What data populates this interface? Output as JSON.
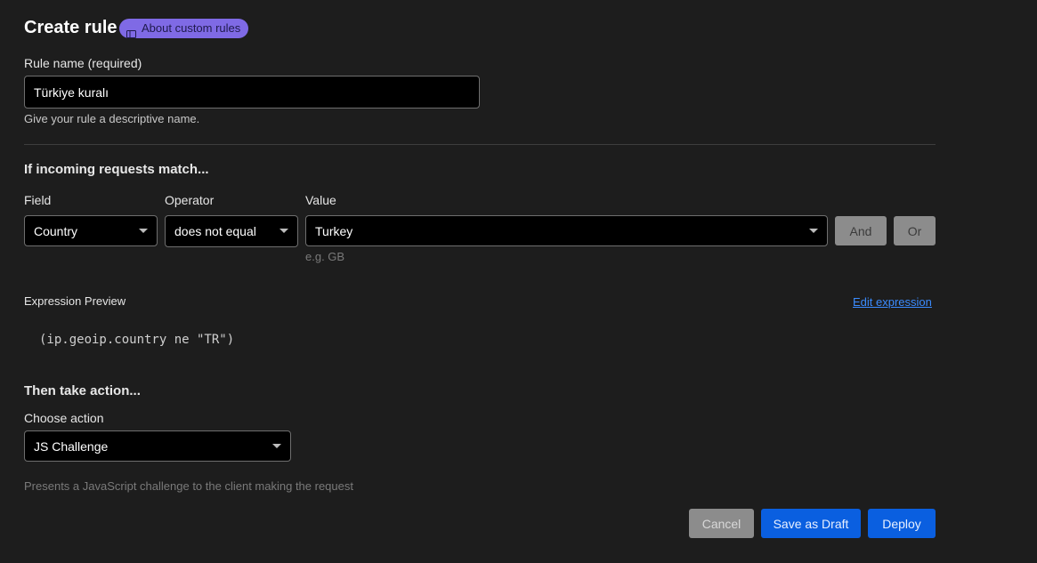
{
  "header": {
    "title": "Create rule",
    "about_link": "About custom rules",
    "about_icon": "book-icon"
  },
  "rule_name": {
    "label": "Rule name (required)",
    "value": "Türkiye kuralı",
    "help": "Give your rule a descriptive name."
  },
  "match": {
    "heading": "If incoming requests match...",
    "field_label": "Field",
    "operator_label": "Operator",
    "value_label": "Value",
    "field_value": "Country",
    "operator_value": "does not equal",
    "value_value": "Turkey",
    "value_hint": "e.g. GB",
    "and_label": "And",
    "or_label": "Or"
  },
  "expression": {
    "label": "Expression Preview",
    "edit_link": "Edit expression",
    "code": "(ip.geoip.country ne \"TR\")"
  },
  "action": {
    "heading": "Then take action...",
    "choose_label": "Choose action",
    "selected": "JS Challenge",
    "description": "Presents a JavaScript challenge to the client making the request"
  },
  "footer": {
    "cancel_label": "Cancel",
    "draft_label": "Save as Draft",
    "deploy_label": "Deploy"
  },
  "colors": {
    "background": "#1d1d1d",
    "accent_pill": "#7f6ae5",
    "primary_button": "#0a5fe0",
    "link": "#3b8cff"
  }
}
